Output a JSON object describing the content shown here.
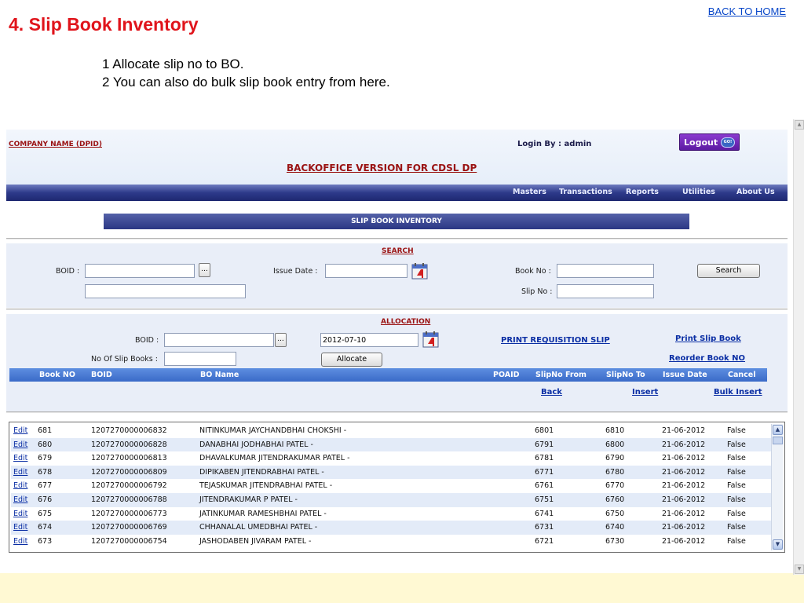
{
  "slide": {
    "title": "4. Slip Book Inventory",
    "back_home": "BACK TO HOME",
    "notes": [
      "1 Allocate slip no to BO.",
      "2 You can also do bulk slip book entry from here."
    ]
  },
  "app": {
    "company": "COMPANY NAME (DPID)",
    "login_by": "Login By : admin",
    "logout_label": "Logout",
    "logout_go": "GO!",
    "version_title": "BACKOFFICE VERSION FOR CDSL DP",
    "menu": [
      "Masters",
      "Transactions",
      "Reports",
      "Utilities",
      "About Us"
    ],
    "section_title": "SLIP BOOK INVENTORY"
  },
  "search": {
    "heading": "SEARCH",
    "boid_label": "BOID :",
    "boid_value": "",
    "boid2_value": "",
    "issue_date_label": "Issue Date :",
    "issue_date_value": "",
    "book_no_label": "Book No :",
    "book_no_value": "",
    "slip_no_label": "Slip No :",
    "slip_no_value": "",
    "lookup_label": "...",
    "search_button": "Search"
  },
  "allocation": {
    "heading": "ALLOCATION",
    "boid_label": "BOID :",
    "boid_value": "",
    "lookup_label": "...",
    "date_value": "2012-07-10",
    "print_requisition": "PRINT REQUISITION SLIP",
    "print_slip_book": "Print Slip Book",
    "no_of_books_label": "No Of Slip Books :",
    "no_of_books_value": "",
    "allocate_button": "Allocate",
    "reorder_link": "Reorder Book NO"
  },
  "grid": {
    "columns": [
      "Book NO",
      "BOID",
      "BO Name",
      "POAID",
      "SlipNo From",
      "SlipNo To",
      "Issue Date",
      "Cancel"
    ],
    "back_link": "Back",
    "insert_link": "Insert",
    "bulk_insert_link": "Bulk Insert"
  },
  "rows": [
    {
      "edit": "Edit",
      "book_no": "681",
      "boid": "1207270000006832",
      "name": "NITINKUMAR JAYCHANDBHAI CHOKSHI -",
      "from": "6801",
      "to": "6810",
      "date": "21-06-2012",
      "cancel": "False"
    },
    {
      "edit": "Edit",
      "book_no": "680",
      "boid": "1207270000006828",
      "name": "DANABHAI JODHABHAI PATEL -",
      "from": "6791",
      "to": "6800",
      "date": "21-06-2012",
      "cancel": "False"
    },
    {
      "edit": "Edit",
      "book_no": "679",
      "boid": "1207270000006813",
      "name": "DHAVALKUMAR JITENDRAKUMAR PATEL -",
      "from": "6781",
      "to": "6790",
      "date": "21-06-2012",
      "cancel": "False"
    },
    {
      "edit": "Edit",
      "book_no": "678",
      "boid": "1207270000006809",
      "name": "DIPIKABEN JITENDRABHAI PATEL -",
      "from": "6771",
      "to": "6780",
      "date": "21-06-2012",
      "cancel": "False"
    },
    {
      "edit": "Edit",
      "book_no": "677",
      "boid": "1207270000006792",
      "name": "TEJASKUMAR JITENDRABHAI PATEL -",
      "from": "6761",
      "to": "6770",
      "date": "21-06-2012",
      "cancel": "False"
    },
    {
      "edit": "Edit",
      "book_no": "676",
      "boid": "1207270000006788",
      "name": "JITENDRAKUMAR P PATEL -",
      "from": "6751",
      "to": "6760",
      "date": "21-06-2012",
      "cancel": "False"
    },
    {
      "edit": "Edit",
      "book_no": "675",
      "boid": "1207270000006773",
      "name": "JATINKUMAR RAMESHBHAI PATEL -",
      "from": "6741",
      "to": "6750",
      "date": "21-06-2012",
      "cancel": "False"
    },
    {
      "edit": "Edit",
      "book_no": "674",
      "boid": "1207270000006769",
      "name": "CHHANALAL UMEDBHAI PATEL -",
      "from": "6731",
      "to": "6740",
      "date": "21-06-2012",
      "cancel": "False"
    },
    {
      "edit": "Edit",
      "book_no": "673",
      "boid": "1207270000006754",
      "name": "JASHODABEN JIVARAM PATEL -",
      "from": "6721",
      "to": "6730",
      "date": "21-06-2012",
      "cancel": "False"
    }
  ],
  "icons": {
    "calendar": "calendar-icon",
    "scroll_up": "chevron-up-icon",
    "scroll_down": "chevron-down-icon"
  },
  "colors": {
    "title_red": "#e0141b",
    "heading_maroon": "#9a1212",
    "link_blue": "#0a2ea4",
    "menubar_navy": "#2d3a8a",
    "grid_header_blue": "#3a6ac8",
    "logout_purple": "#6b25b3",
    "band_yellow": "#fff9d3"
  }
}
